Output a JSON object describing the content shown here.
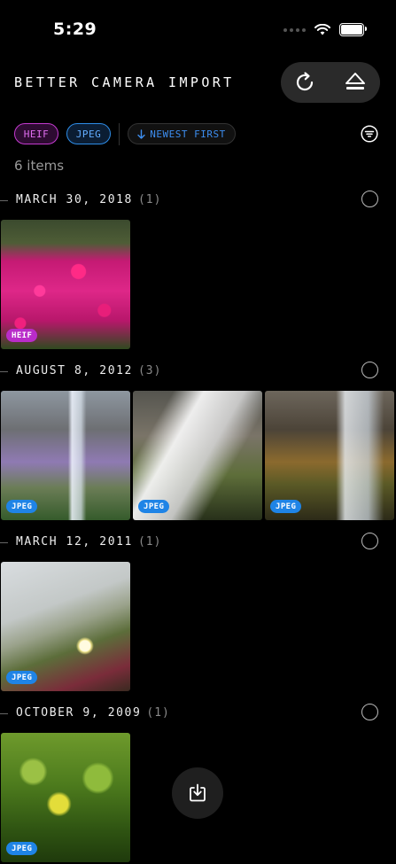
{
  "status": {
    "time": "5:29"
  },
  "header": {
    "title": "BETTER CAMERA IMPORT",
    "refresh_icon": "refresh-icon",
    "eject_icon": "eject-icon"
  },
  "filters": {
    "heif": "HEIF",
    "jpeg": "JPEG",
    "sort": "NEWEST FIRST"
  },
  "count": "6 items",
  "sections": [
    {
      "date": "MARCH 30, 2018",
      "count": "(1)",
      "photos": [
        {
          "badge": "HEIF"
        }
      ]
    },
    {
      "date": "AUGUST 8, 2012",
      "count": "(3)",
      "photos": [
        {
          "badge": "JPEG"
        },
        {
          "badge": "JPEG"
        },
        {
          "badge": "JPEG"
        }
      ]
    },
    {
      "date": "MARCH 12, 2011",
      "count": "(1)",
      "photos": [
        {
          "badge": "JPEG"
        }
      ]
    },
    {
      "date": "OCTOBER 9, 2009",
      "count": "(1)",
      "photos": [
        {
          "badge": "JPEG"
        }
      ]
    }
  ],
  "colors": {
    "heif": "#b92cc9",
    "jpeg": "#1f84e6",
    "sort": "#3d8ef0",
    "pill": "#2a2a2a"
  }
}
